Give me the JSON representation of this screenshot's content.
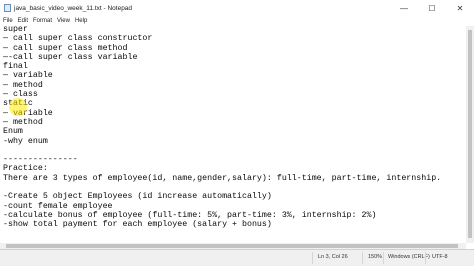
{
  "window": {
    "title": "java_basic_video_week_11.txt - Notepad",
    "controls": {
      "minimize": "—",
      "maximize": "☐",
      "close": "✕"
    }
  },
  "menu": [
    "File",
    "Edit",
    "Format",
    "View",
    "Help"
  ],
  "editor": {
    "lines": [
      "super",
      "— call super class constructor",
      "— call super class method",
      "—-call super class variable",
      "final",
      "— variable",
      "— method",
      "— class",
      "static",
      "— variable",
      "— method",
      "Enum",
      "-why enum",
      "",
      "---------------",
      "Practice:",
      "There are 3 types of employee(id, name,gender,salary): full-time, part-time, internship.",
      "",
      "-Create 5 object Employees (id increase automatically)",
      "-count female employee",
      "-calculate bonus of employee (full-time: 5%, part-time: 3%, internship: 2%)",
      "-show total payment for each employee (salary + bonus)"
    ]
  },
  "status": {
    "position": "Ln 3, Col 26",
    "zoom": "150%",
    "line_ending": "Windows (CRLF)",
    "encoding": "UTF-8"
  },
  "colors": {
    "highlight": "#ffec00"
  }
}
